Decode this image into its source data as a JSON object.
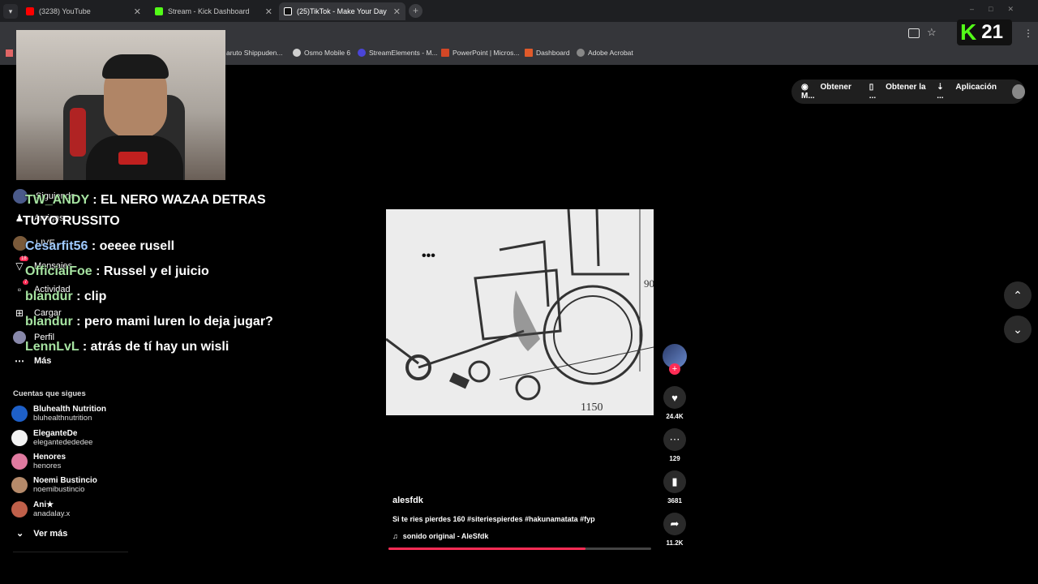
{
  "browser": {
    "tabs": [
      {
        "label": "(3238) YouTube",
        "color": "#ff0000"
      },
      {
        "label": "Stream - Kick Dashboard",
        "color": "#53fc18"
      },
      {
        "label": "(25)TikTok - Make Your Day",
        "color": "#ffffff"
      }
    ],
    "bookmarks": [
      {
        "label": "aruto Shippuden...",
        "color": "#f0a030"
      },
      {
        "label": "Osmo Mobile 6",
        "color": "#cccccc"
      },
      {
        "label": "StreamElements - M...",
        "color": "#4a45d8"
      },
      {
        "label": "PowerPoint | Micros...",
        "color": "#d24726"
      },
      {
        "label": "Dashboard",
        "color": "#e05a2a"
      },
      {
        "label": "Adobe Acrobat",
        "color": "#aaaaaa"
      }
    ]
  },
  "overlay": {
    "viewer_count": "21",
    "chat": [
      {
        "user": "TW_ANDY",
        "text": " : EL NERO WAZAA DETRAS",
        "user_color": "#a6e3a1"
      },
      {
        "user": "",
        "text": "TUYO RUSSITO",
        "user_color": "#a6e3a1"
      },
      {
        "user": "Cesarfit56",
        "text": " : oeeee rusell",
        "user_color": "#9ec9ff"
      },
      {
        "user": "OfficialFoe",
        "text": " : Russel y el juicio",
        "user_color": "#a6e3a1"
      },
      {
        "user": "blandur",
        "text": " : clip",
        "user_color": "#a6e3a1"
      },
      {
        "user": "blandur",
        "text": " : pero mami luren lo deja jugar?",
        "user_color": "#a6e3a1"
      },
      {
        "user": "LennLvL",
        "text": " : atrás de tí hay un wisli",
        "user_color": "#a6e3a1"
      }
    ]
  },
  "sidebar": {
    "items": [
      {
        "label": "Siguiendo",
        "icon": "following-icon"
      },
      {
        "label": "Amigos",
        "icon": "friends-icon"
      },
      {
        "label": "LIVE",
        "icon": "live-icon"
      },
      {
        "label": "Mensajes",
        "icon": "messages-icon",
        "badge": "18"
      },
      {
        "label": "Actividad",
        "icon": "activity-icon",
        "badge": "7"
      },
      {
        "label": "Cargar",
        "icon": "upload-icon"
      },
      {
        "label": "Perfil",
        "icon": "profile-icon"
      },
      {
        "label": "Más",
        "icon": "more-icon"
      }
    ],
    "following_title": "Cuentas que sigues",
    "following": [
      {
        "name": "Bluhealth Nutrition",
        "handle": "bluhealthnutrition",
        "color": "#1e60c8"
      },
      {
        "name": "EleganteDe",
        "handle": "elegantedededee",
        "color": "#f2f2f2"
      },
      {
        "name": "Henores",
        "handle": "henores",
        "color": "#e07aa0"
      },
      {
        "name": "Noemi Bustincio",
        "handle": "noemibustincio",
        "color": "#b58a6a"
      },
      {
        "name": "Ani★",
        "handle": "anadalay.x",
        "color": "#c0604a"
      }
    ],
    "see_more": "Ver más"
  },
  "header": {
    "get_coins": "Obtener M...",
    "get_app": "Obtener la ...",
    "app": "Aplicación ..."
  },
  "video": {
    "author": "alesfdk",
    "caption": "Si te ries pierdes 160 #siteriespierdes #hakunamatata #fyp",
    "sound": "sonido original - AleSfdk",
    "dimension_label": "1150",
    "dimension_label_2": "90",
    "progress": 0.75
  },
  "actions": {
    "likes": "24.4K",
    "comments": "129",
    "saves": "3681",
    "shares": "11.2K"
  }
}
